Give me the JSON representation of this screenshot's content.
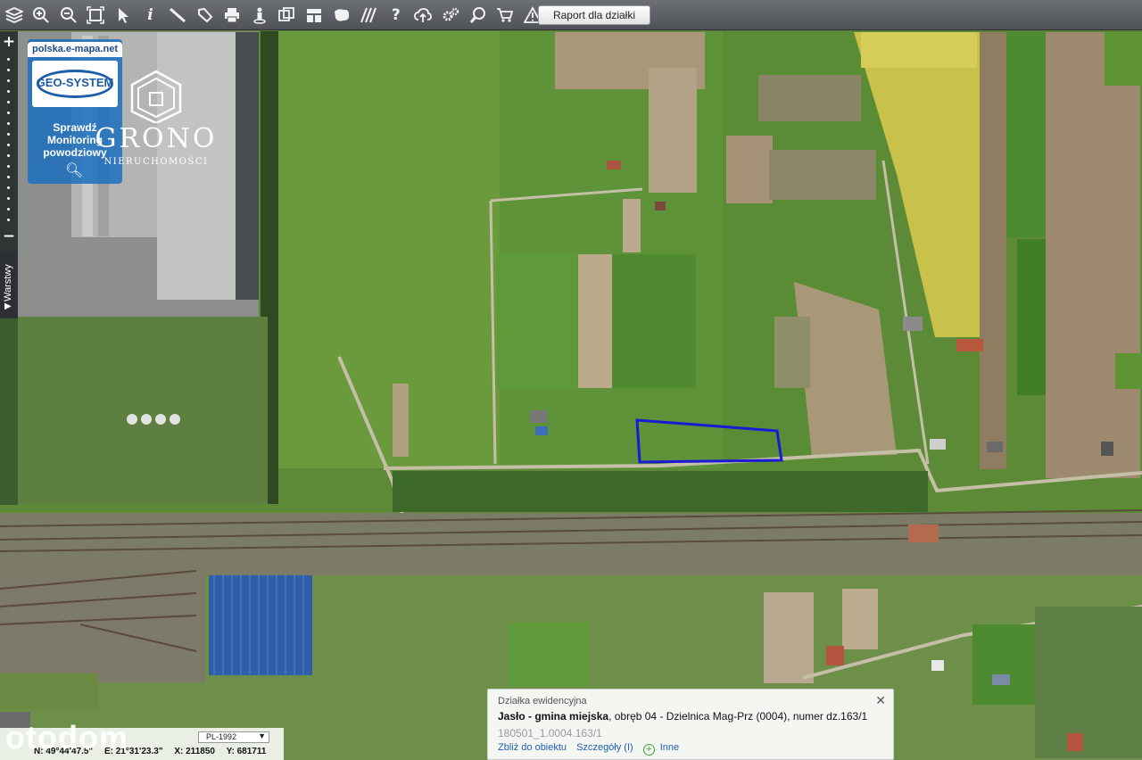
{
  "toolbar": {
    "icons": [
      "layers-icon",
      "zoom-in-icon",
      "zoom-out-icon",
      "zoom-extent-icon",
      "pointer-icon",
      "info-icon",
      "measure-distance-icon",
      "measure-area-icon",
      "print-icon",
      "street-view-icon",
      "coordinates-icon",
      "layout-icon",
      "map-icon",
      "hatch-icon",
      "help-icon",
      "upload-cloud-icon",
      "settings-icon",
      "search-parcel-icon",
      "cart-icon",
      "warning-icon"
    ],
    "report_label": "Raport dla działki"
  },
  "zoombar": {
    "plus": "+",
    "minus": "−"
  },
  "layers_tab": {
    "label": "Warstwy",
    "arrow": "▶"
  },
  "geo_badge": {
    "url": "polska.e-mapa.net",
    "logo": "GEO-SYSTEM",
    "line1": "Sprawdź",
    "line2": "Monitoring",
    "line3": "powodziowy"
  },
  "watermark": {
    "name": "GRONO",
    "sub": "NIERUCHOMOŚCI"
  },
  "coords": {
    "crs": "PL-1992",
    "n": "N: 49°44'47.5\"",
    "e": "E: 21°31'23.3\"",
    "x": "X: 211850",
    "y": "Y: 681711"
  },
  "brand": "otodom",
  "parcel": {
    "title": "Działka ewidencyjna",
    "place": "Jasło - gmina miejska",
    "obreb": ", obręb 04 - Dzielnica Mag-Prz (0004)",
    "numer": ", numer dz.163/1",
    "id": "180501_1.0004.163/1",
    "link_zoom": "Zbliż do obiektu",
    "link_details": "Szczegóły (I)",
    "link_other": "Inne",
    "close": "✕"
  },
  "colors": {
    "parcel_outline": "#1a1ad6",
    "toolbar": "#5a5e63",
    "link": "#1f5fb8"
  }
}
